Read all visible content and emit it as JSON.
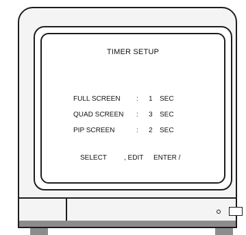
{
  "screen": {
    "title": "TIMER SETUP",
    "settings": [
      {
        "label": "FULL SCREEN",
        "separator": ":",
        "value": "1",
        "unit": "SEC"
      },
      {
        "label": "QUAD SCREEN",
        "separator": ":",
        "value": "3",
        "unit": "SEC"
      },
      {
        "label": "PIP SCREEN",
        "separator": ":",
        "value": "2",
        "unit": "SEC"
      }
    ],
    "footer": {
      "select": "SELECT",
      "edit": ", EDIT",
      "enter": "ENTER /"
    }
  },
  "colors": {
    "outline": "#1c1c1c",
    "body": "#f4f4f4",
    "shadow": "#8c8c8c"
  },
  "icons": {
    "power_led": "power-led-icon",
    "power_button": "power-button-icon"
  }
}
